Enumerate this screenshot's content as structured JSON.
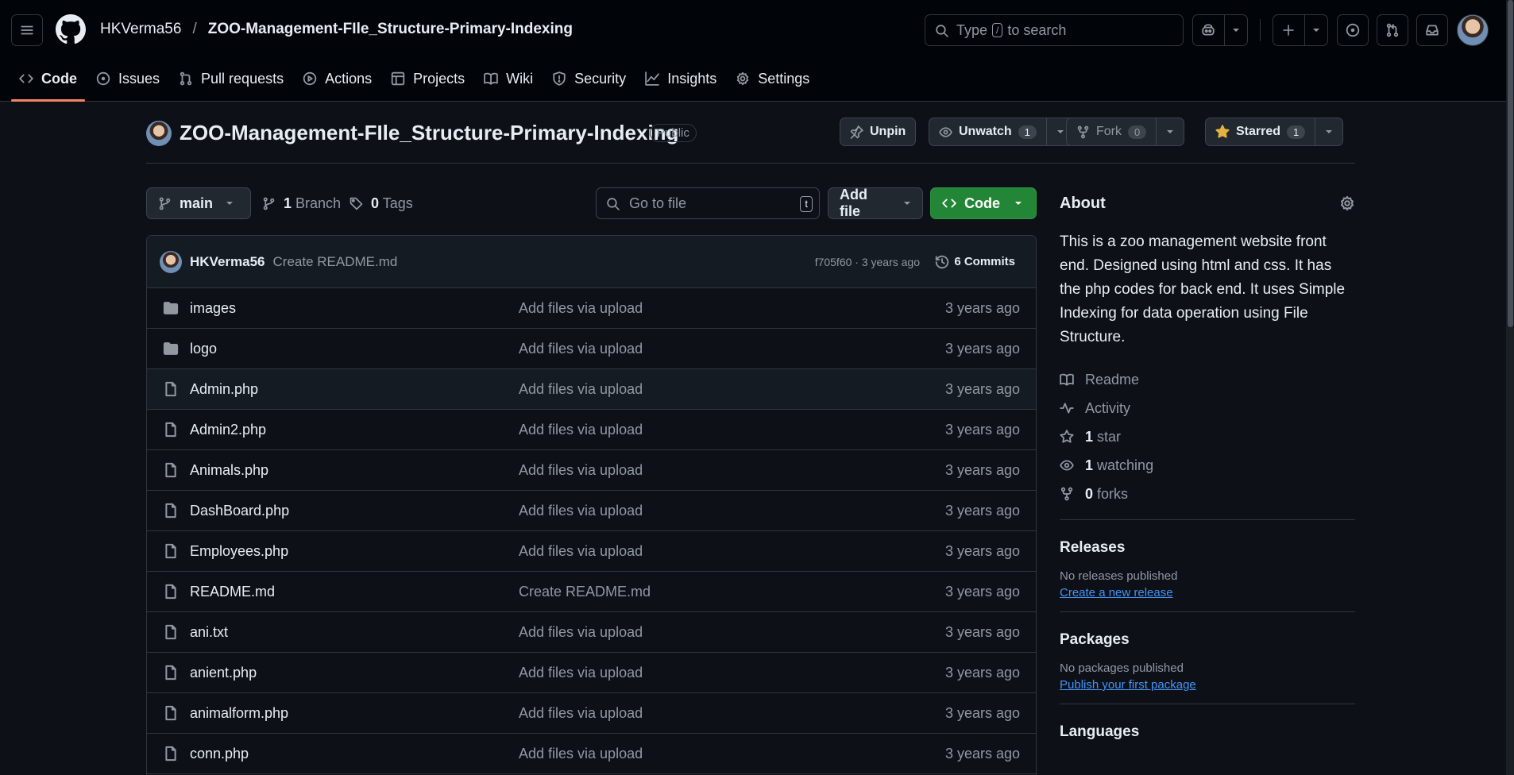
{
  "header": {
    "owner": "HKVerma56",
    "separator": "/",
    "repo": "ZOO-Management-FIle_Structure-Primary-Indexing",
    "search_prefix": "Type",
    "search_key": "/",
    "search_suffix": "to search"
  },
  "nav": {
    "code": "Code",
    "issues": "Issues",
    "pull_requests": "Pull requests",
    "actions": "Actions",
    "projects": "Projects",
    "wiki": "Wiki",
    "security": "Security",
    "insights": "Insights",
    "settings": "Settings"
  },
  "repo": {
    "name": "ZOO-Management-FIle_Structure-Primary-Indexing",
    "visibility": "Public",
    "unpin_label": "Unpin",
    "watch_label": "Unwatch",
    "watch_count": "1",
    "fork_label": "Fork",
    "fork_count": "0",
    "star_label": "Starred",
    "star_count": "1"
  },
  "toolbar": {
    "branch": "main",
    "branch_count": "1",
    "branch_label": "Branch",
    "tag_count": "0",
    "tag_label": "Tags",
    "goto_placeholder": "Go to file",
    "goto_key": "t",
    "add_file": "Add file",
    "code": "Code"
  },
  "commit": {
    "author": "HKVerma56",
    "message": "Create README.md",
    "meta": "f705f60 · 3 years ago",
    "count_label": "6 Commits"
  },
  "files": [
    {
      "name": "images",
      "type": "folder",
      "message": "Add files via upload",
      "date": "3 years ago"
    },
    {
      "name": "logo",
      "type": "folder",
      "message": "Add files via upload",
      "date": "3 years ago"
    },
    {
      "name": "Admin.php",
      "type": "file",
      "message": "Add files via upload",
      "date": "3 years ago"
    },
    {
      "name": "Admin2.php",
      "type": "file",
      "message": "Add files via upload",
      "date": "3 years ago"
    },
    {
      "name": "Animals.php",
      "type": "file",
      "message": "Add files via upload",
      "date": "3 years ago"
    },
    {
      "name": "DashBoard.php",
      "type": "file",
      "message": "Add files via upload",
      "date": "3 years ago"
    },
    {
      "name": "Employees.php",
      "type": "file",
      "message": "Add files via upload",
      "date": "3 years ago"
    },
    {
      "name": "README.md",
      "type": "file",
      "message": "Create README.md",
      "date": "3 years ago"
    },
    {
      "name": "ani.txt",
      "type": "file",
      "message": "Add files via upload",
      "date": "3 years ago"
    },
    {
      "name": "anient.php",
      "type": "file",
      "message": "Add files via upload",
      "date": "3 years ago"
    },
    {
      "name": "animalform.php",
      "type": "file",
      "message": "Add files via upload",
      "date": "3 years ago"
    },
    {
      "name": "conn.php",
      "type": "file",
      "message": "Add files via upload",
      "date": "3 years ago"
    }
  ],
  "about": {
    "heading": "About",
    "description": "This is a zoo management website front end. Designed using html and css. It has the php codes for back end. It uses Simple Indexing for data operation using File Structure.",
    "readme": "Readme",
    "activity": "Activity",
    "stars_num": "1",
    "stars_label": "star",
    "watching_num": "1",
    "watching_label": "watching",
    "forks_num": "0",
    "forks_label": "forks"
  },
  "releases": {
    "heading": "Releases",
    "none": "No releases published",
    "link": "Create a new release"
  },
  "packages": {
    "heading": "Packages",
    "none": "No packages published",
    "link": "Publish your first package"
  },
  "languages": {
    "heading": "Languages"
  },
  "colors": {
    "accent_green": "#238636",
    "tab_underline": "#f78166",
    "link_blue": "#4493f8",
    "star_yellow": "#e3b341"
  }
}
